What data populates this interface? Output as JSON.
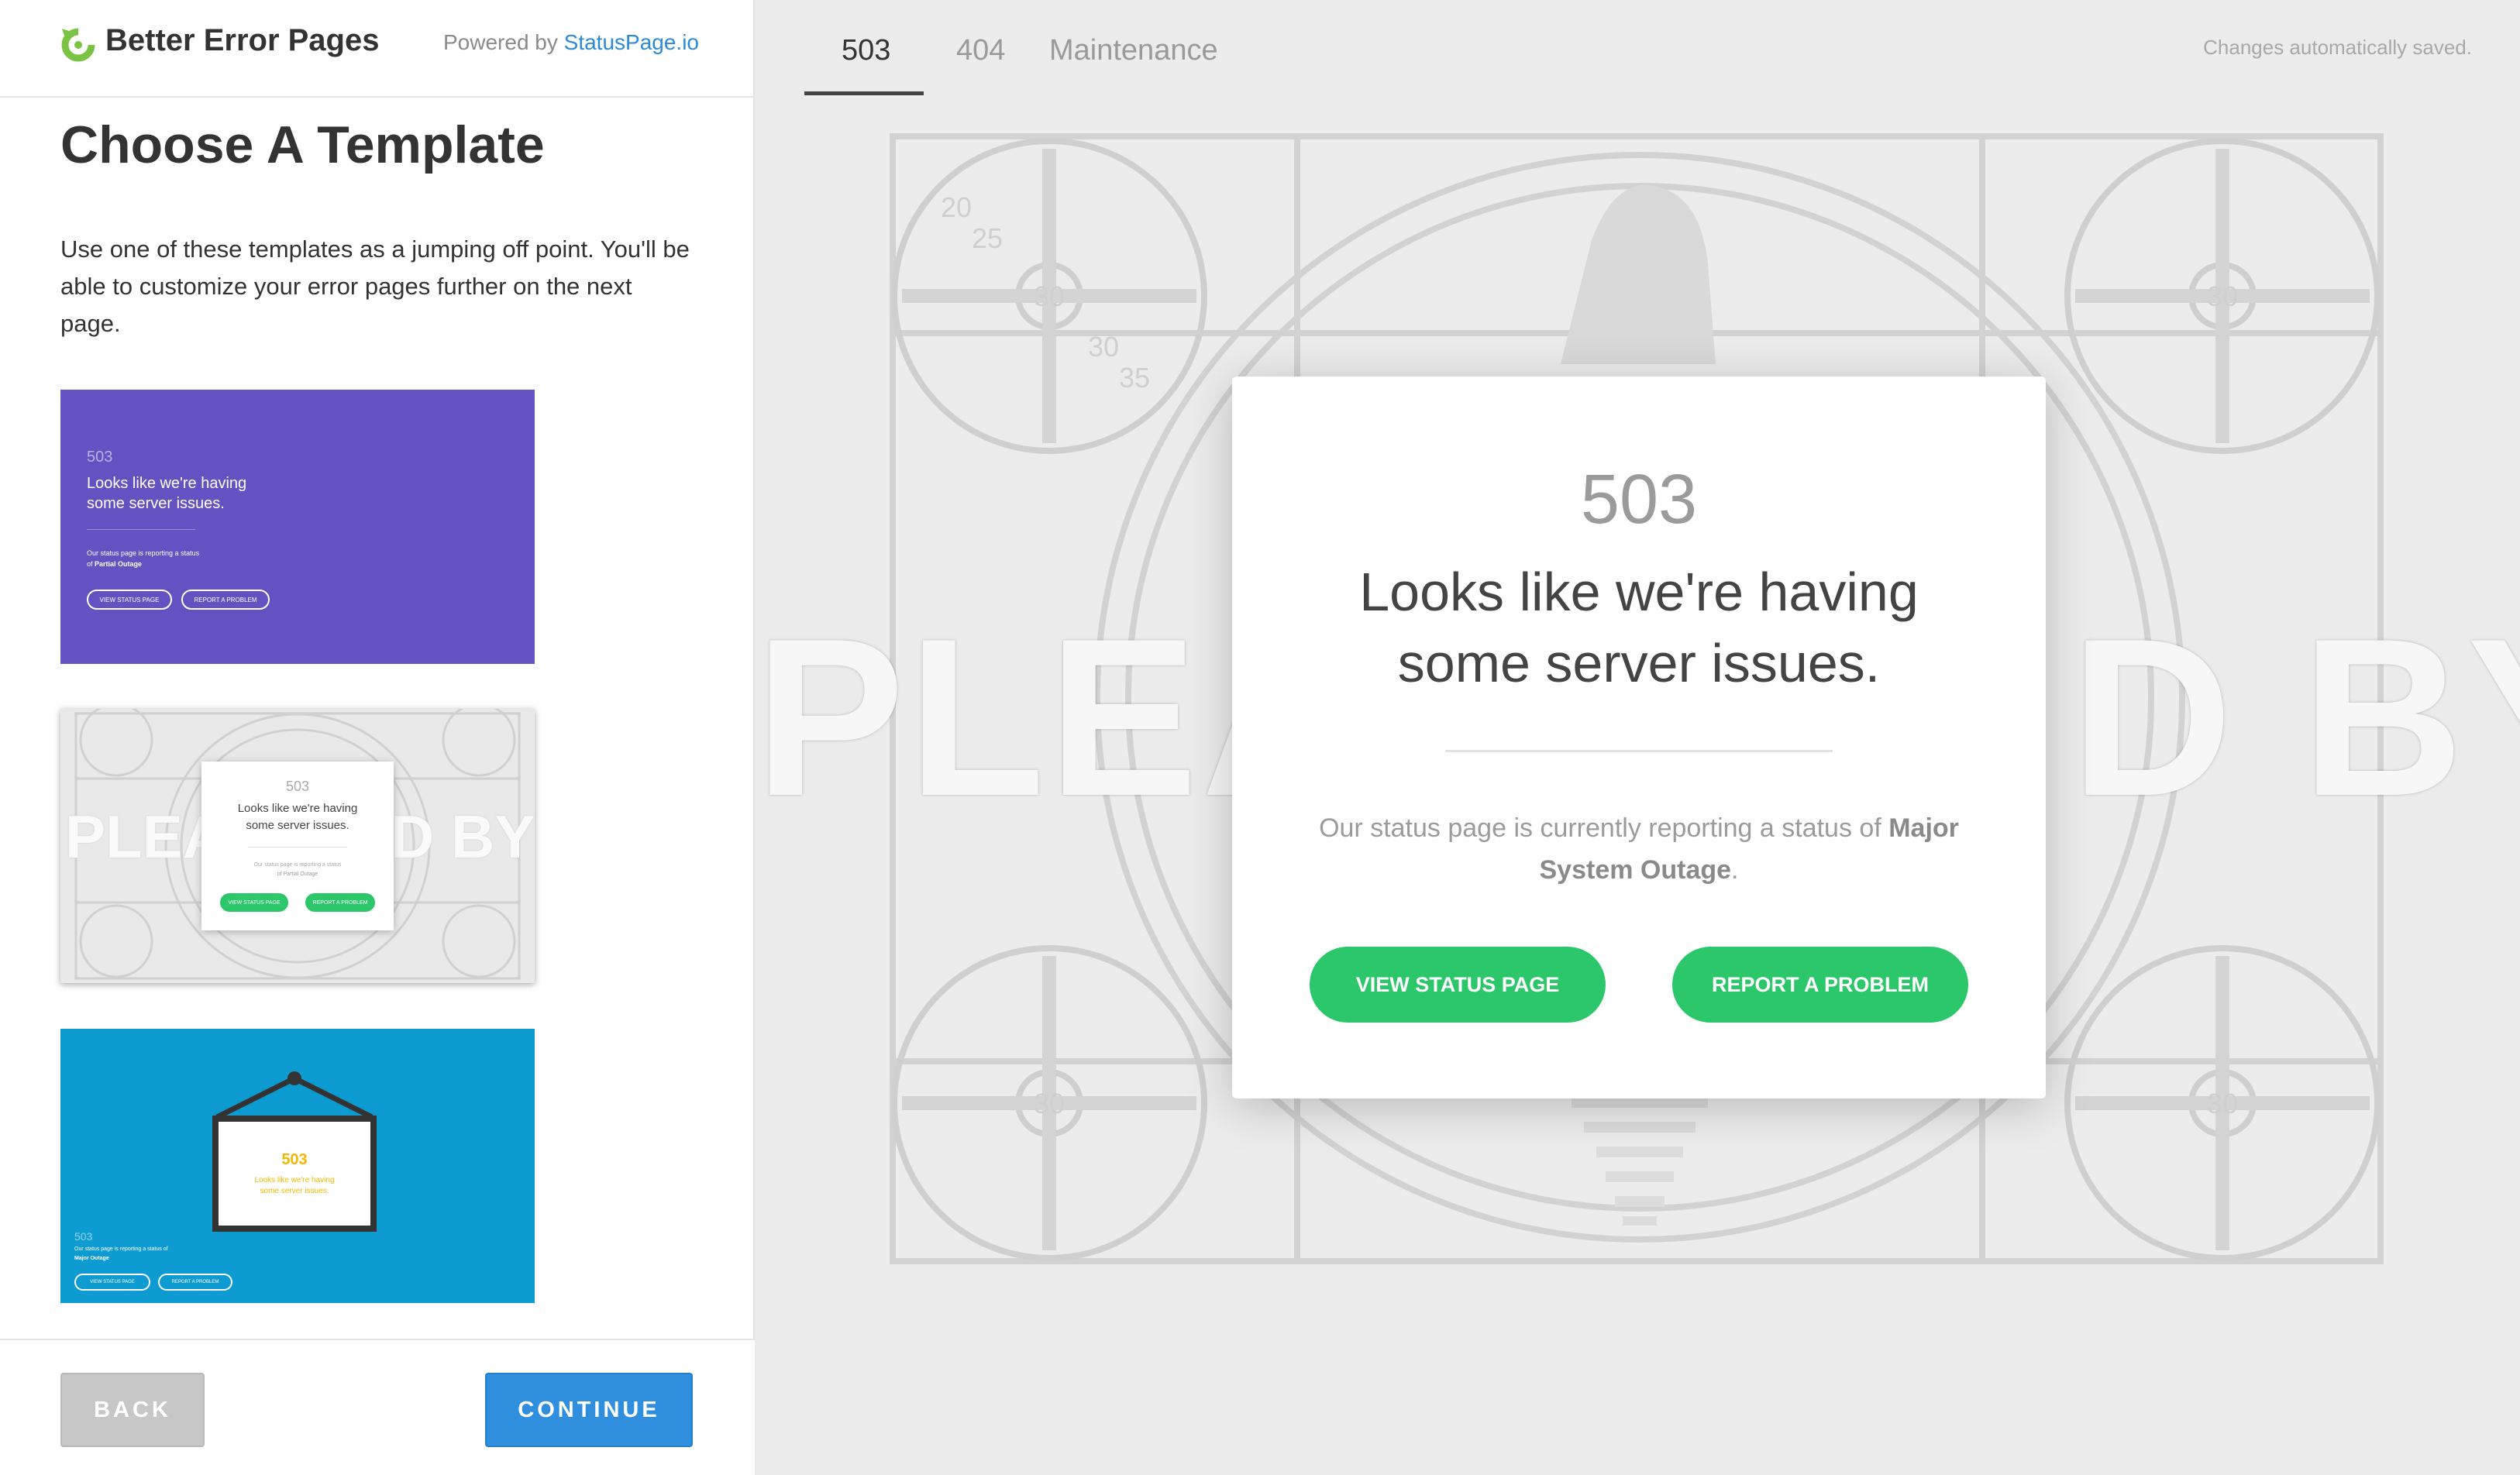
{
  "brand": {
    "name": "Better Error Pages",
    "powered_prefix": "Powered by",
    "powered_link": "StatusPage.io"
  },
  "sidebar": {
    "title": "Choose A Template",
    "description": "Use one of these templates as a jumping off point. You'll be able to customize your error pages further on the next page.",
    "templates": [
      {
        "code": "503",
        "headline_1": "Looks like we're having",
        "headline_2": "some server issues.",
        "status_line": "Our status page is reporting a status",
        "status_prefix": "of",
        "status_value": "Partial Outage",
        "btn_view": "VIEW STATUS PAGE",
        "btn_report": "REPORT A PROBLEM"
      },
      {
        "code": "503",
        "headline_1": "Looks like we're having",
        "headline_2": "some server issues.",
        "status_line": "Our status page is reporting a status",
        "status_value": "of Partial Outage",
        "watermark_left": "PLEA",
        "watermark_right": "D BY",
        "btn_view": "VIEW STATUS PAGE",
        "btn_report": "REPORT A PROBLEM"
      },
      {
        "sign_code": "503",
        "sign_headline_1": "Looks like we're having",
        "sign_headline_2": "some server issues.",
        "code": "503",
        "status_line": "Our status page is reporting a status of",
        "status_value": "Major Outage",
        "btn_view": "VIEW STATUS PAGE",
        "btn_report": "REPORT A PROBLEM"
      }
    ],
    "back_label": "BACK",
    "continue_label": "CONTINUE"
  },
  "tabs": [
    {
      "label": "503",
      "active": true
    },
    {
      "label": "404",
      "active": false
    },
    {
      "label": "Maintenance",
      "active": false
    }
  ],
  "saved_note": "Changes automatically saved.",
  "preview": {
    "watermark_left": "PLEA",
    "watermark_right": "D BY",
    "pattern_numbers": [
      "20",
      "25",
      "30",
      "30",
      "35"
    ],
    "code": "503",
    "headline_1": "Looks like we're having",
    "headline_2": "some server issues.",
    "status_prefix": "Our status page is currently reporting a status of",
    "status_value": "Major System Outage",
    "status_suffix": ".",
    "btn_view": "VIEW STATUS PAGE",
    "btn_report": "REPORT A PROBLEM"
  },
  "colors": {
    "accent_blue": "#2f8fde",
    "green": "#2bc76a",
    "template_purple": "#6452c2",
    "template_blue": "#0e9bd2",
    "logo_green": "#7bc443"
  }
}
